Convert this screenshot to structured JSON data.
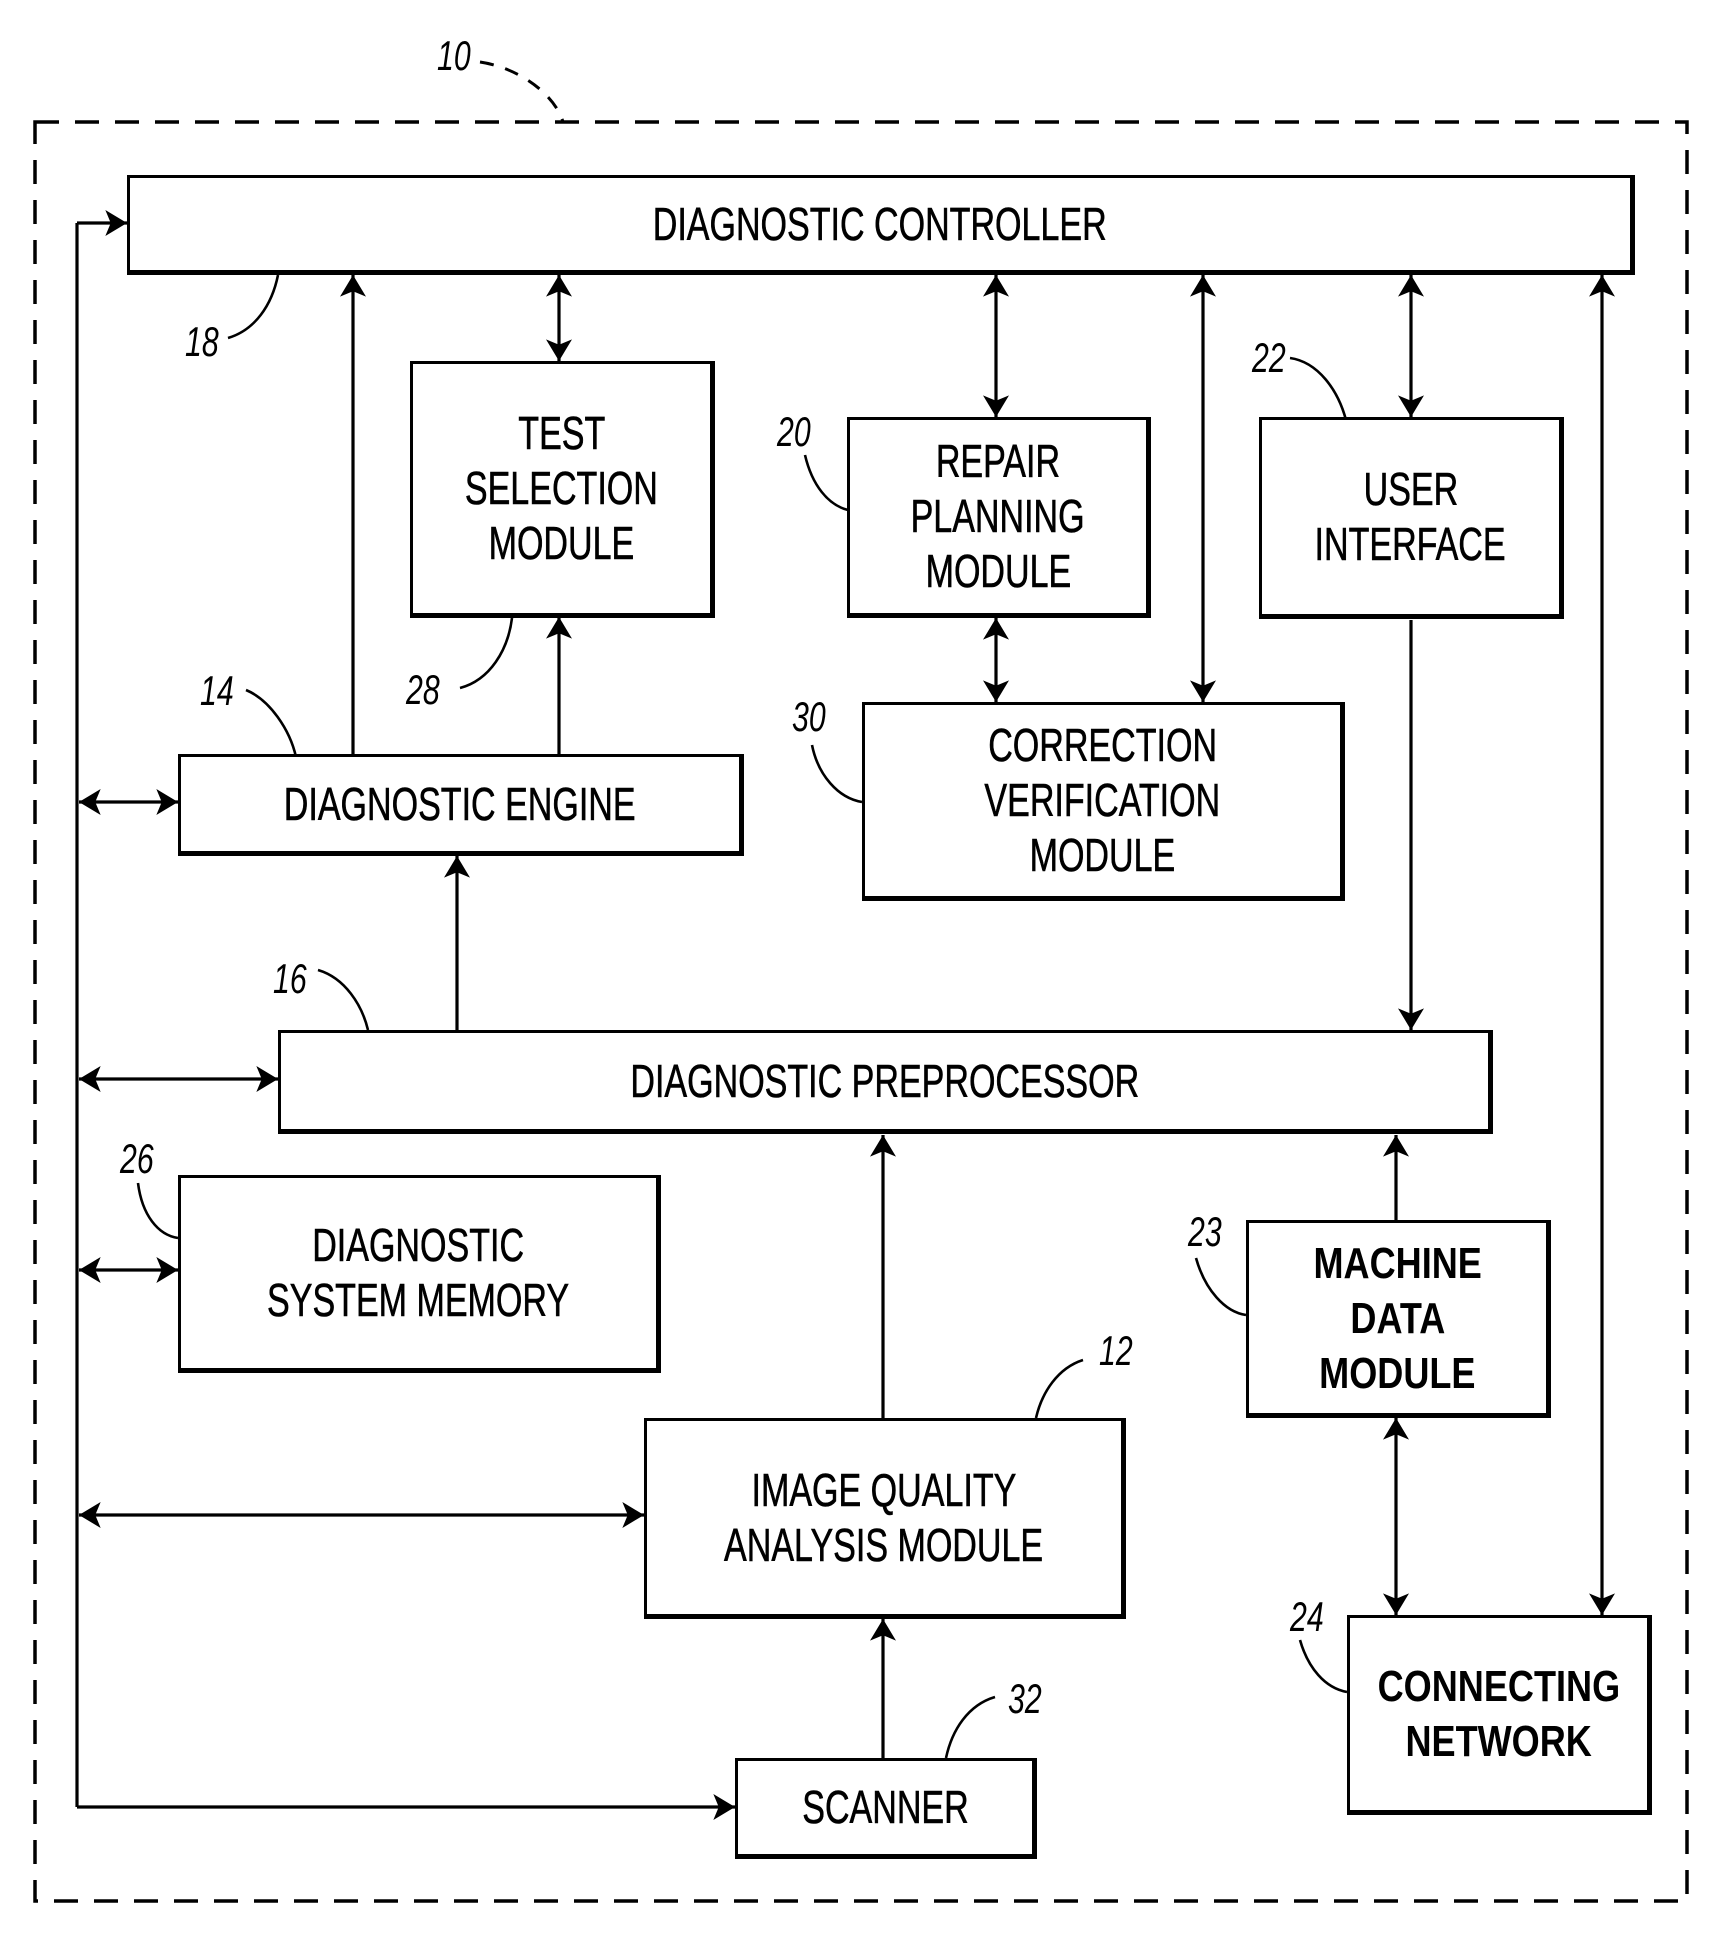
{
  "figure": {
    "system_ref": "10",
    "boxes": {
      "controller": {
        "ref": "18",
        "lines": [
          "DIAGNOSTIC CONTROLLER"
        ]
      },
      "test_selection": {
        "ref": "28",
        "lines": [
          "TEST",
          "SELECTION",
          "MODULE"
        ]
      },
      "repair_planning": {
        "ref": "20",
        "lines": [
          "REPAIR",
          "PLANNING",
          "MODULE"
        ]
      },
      "user_interface": {
        "ref": "22",
        "lines": [
          "USER",
          "INTERFACE"
        ]
      },
      "engine": {
        "ref": "14",
        "lines": [
          "DIAGNOSTIC ENGINE"
        ]
      },
      "correction": {
        "ref": "30",
        "lines": [
          "CORRECTION",
          "VERIFICATION",
          "MODULE"
        ]
      },
      "preprocessor": {
        "ref": "16",
        "lines": [
          "DIAGNOSTIC PREPROCESSOR"
        ]
      },
      "memory": {
        "ref": "26",
        "lines": [
          "DIAGNOSTIC",
          "SYSTEM MEMORY"
        ]
      },
      "machine_data": {
        "ref": "23",
        "lines": [
          "MACHINE",
          "DATA",
          "MODULE"
        ]
      },
      "image_quality": {
        "ref": "12",
        "lines": [
          "IMAGE QUALITY",
          "ANALYSIS MODULE"
        ]
      },
      "network": {
        "ref": "24",
        "lines": [
          "CONNECTING",
          "NETWORK"
        ]
      },
      "scanner": {
        "ref": "32",
        "lines": [
          "SCANNER"
        ]
      }
    },
    "connections": [
      {
        "from": "left-bus",
        "to": "controller",
        "direction": "one-way"
      },
      {
        "from": "left-bus",
        "to": "scanner",
        "direction": "one-way"
      },
      {
        "from": "left-bus",
        "to": "engine",
        "direction": "two-way"
      },
      {
        "from": "left-bus",
        "to": "preprocessor",
        "direction": "two-way"
      },
      {
        "from": "left-bus",
        "to": "memory",
        "direction": "two-way"
      },
      {
        "from": "left-bus",
        "to": "image_quality",
        "direction": "two-way"
      },
      {
        "from": "engine",
        "to": "controller",
        "direction": "one-way"
      },
      {
        "from": "engine",
        "to": "test_selection",
        "direction": "one-way"
      },
      {
        "from": "test_selection",
        "to": "controller",
        "direction": "two-way"
      },
      {
        "from": "repair_planning",
        "to": "controller",
        "direction": "two-way"
      },
      {
        "from": "repair_planning",
        "to": "correction",
        "direction": "two-way"
      },
      {
        "from": "correction",
        "to": "controller",
        "direction": "two-way"
      },
      {
        "from": "user_interface",
        "to": "controller",
        "direction": "two-way"
      },
      {
        "from": "user_interface",
        "to": "preprocessor",
        "direction": "one-way"
      },
      {
        "from": "preprocessor",
        "to": "engine",
        "direction": "one-way"
      },
      {
        "from": "image_quality",
        "to": "preprocessor",
        "direction": "one-way"
      },
      {
        "from": "scanner",
        "to": "image_quality",
        "direction": "one-way"
      },
      {
        "from": "machine_data",
        "to": "preprocessor",
        "direction": "one-way"
      },
      {
        "from": "machine_data",
        "to": "network",
        "direction": "two-way"
      },
      {
        "from": "network",
        "to": "controller",
        "direction": "two-way"
      }
    ]
  }
}
